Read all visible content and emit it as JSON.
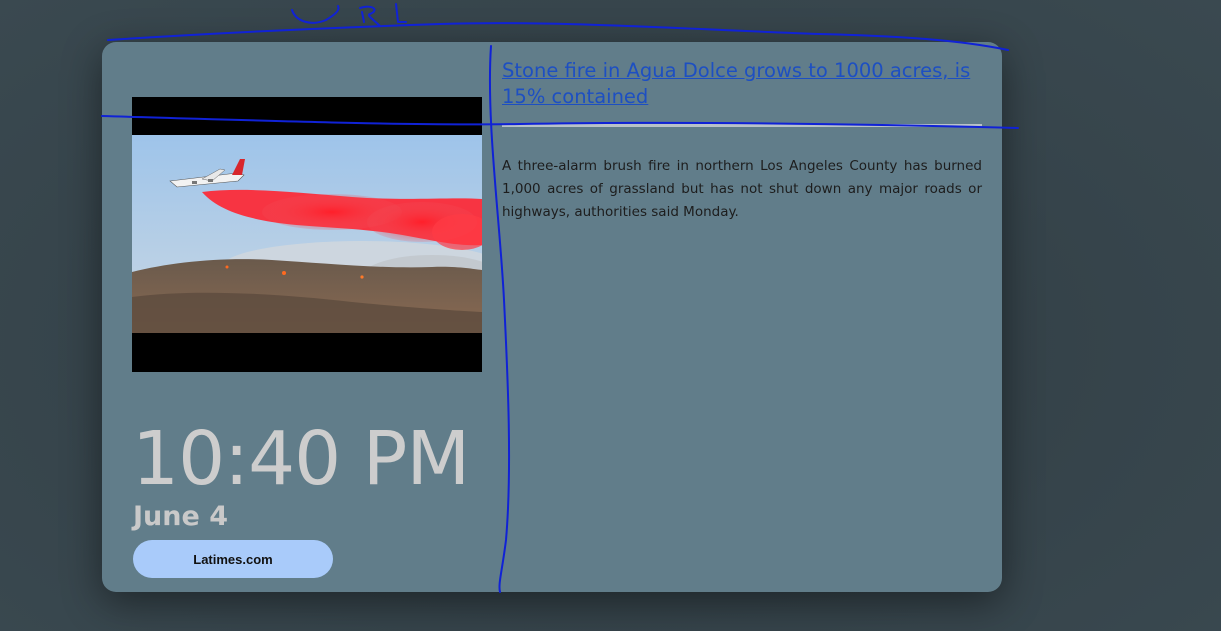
{
  "article": {
    "headline": "Stone fire in Agua Dolce grows to 1000 acres, is 15% contained",
    "summary": "A three-alarm brush fire in northern Los Angeles County has burned 1,000 acres of grassland but has not shut down any major roads or highways, authorities said Monday."
  },
  "clock": {
    "time": "10:40 PM",
    "date": "June 4"
  },
  "source": {
    "label": "Latimes.com"
  },
  "image": {
    "alt": "Aircraft dropping red fire retardant over smoking hillside"
  },
  "annotation": {
    "text": "URL",
    "color": "#1022d6"
  },
  "colors": {
    "background": "#36444b",
    "card": "#617d8a",
    "link": "#1d4fc2",
    "button": "#a9cbfa",
    "clock_text": "#cdcdcd"
  }
}
